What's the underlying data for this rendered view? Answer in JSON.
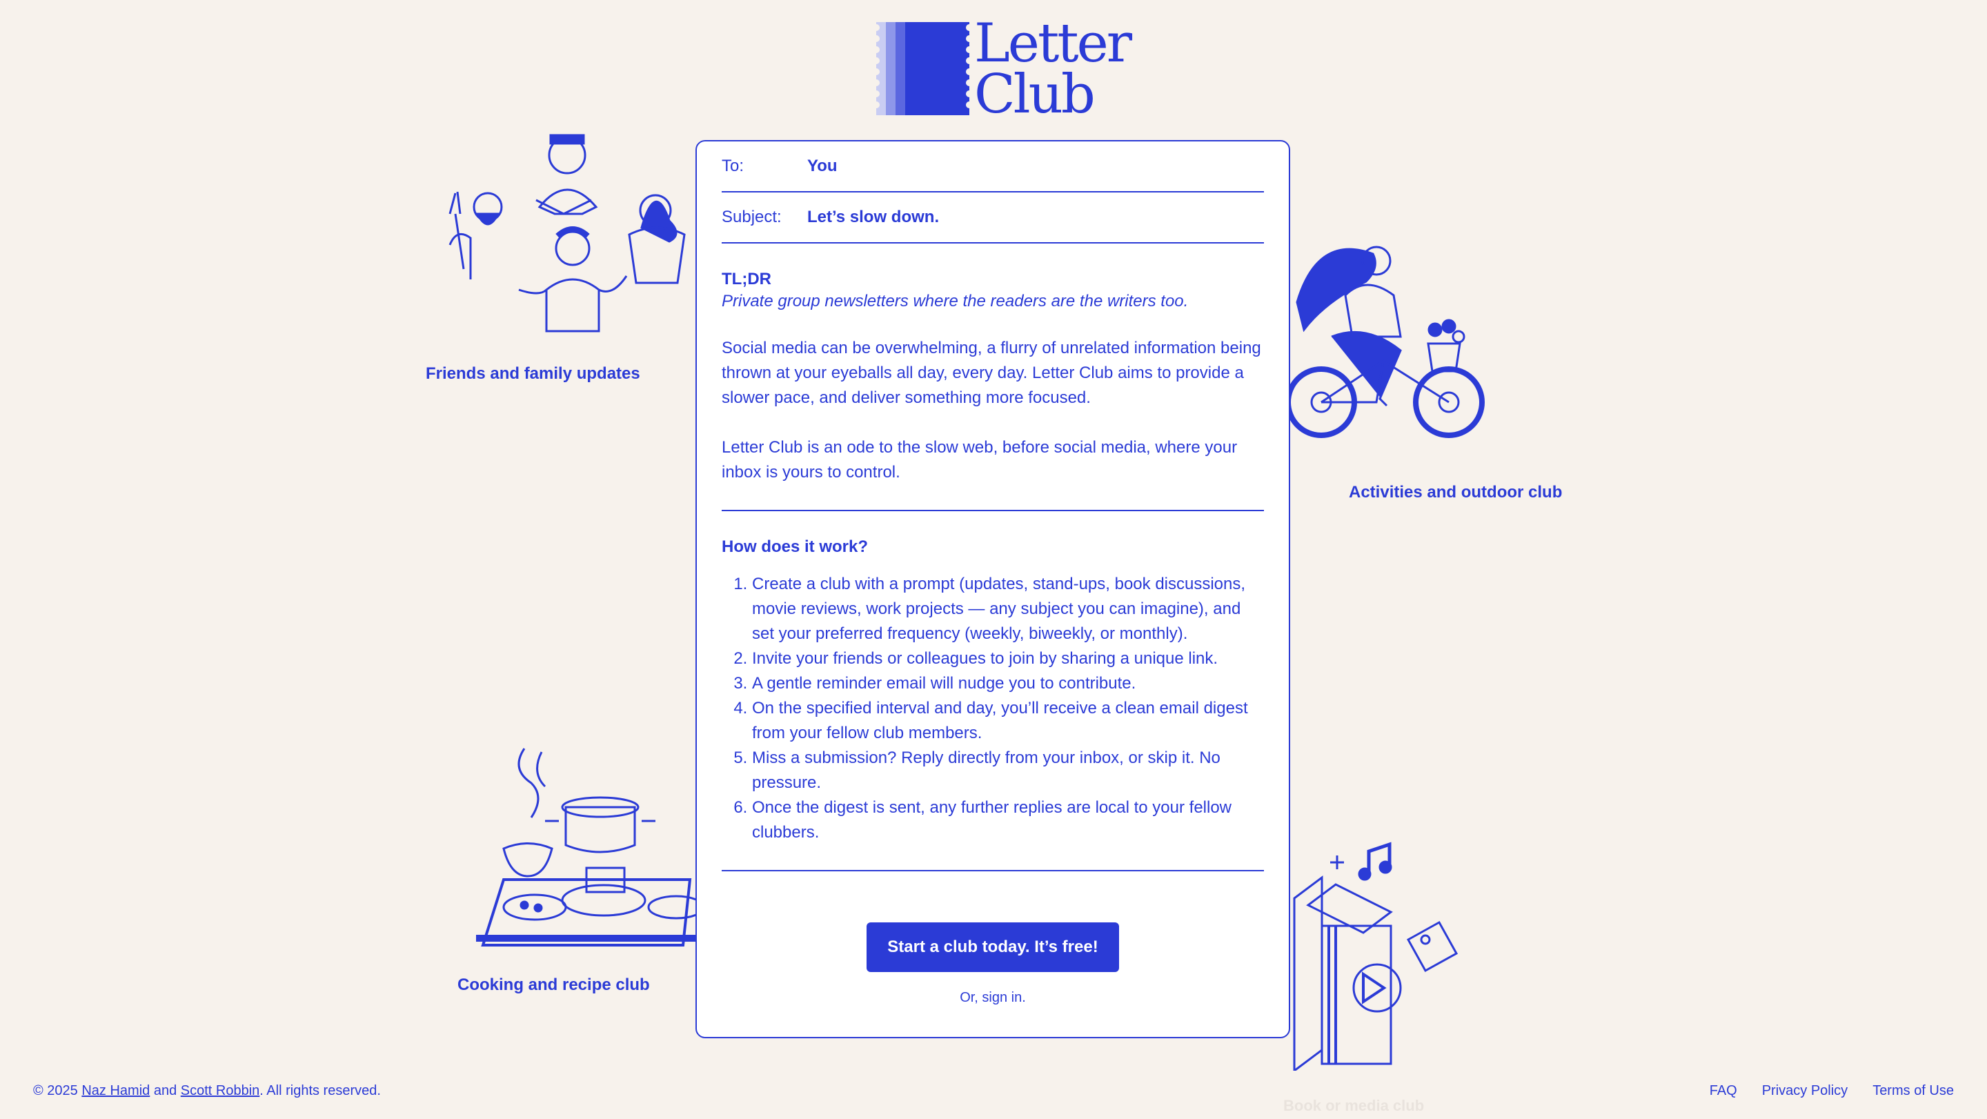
{
  "logo": {
    "line1": "Letter",
    "line2": "Club"
  },
  "letter": {
    "to_label": "To:",
    "to_value": "You",
    "subject_label": "Subject:",
    "subject_value": "Let’s slow down.",
    "tldr_title": "TL;DR",
    "tldr_sub": "Private group newsletters where the readers are the writers too.",
    "para1": "Social media can be overwhelming, a flurry of unrelated information being thrown at your eyeballs all day, every day. Letter Club aims to provide a slower pace, and deliver something more focused.",
    "para2": "Letter Club is an ode to the slow web, before social media, where your inbox is yours to control.",
    "how_title": "How does it work?",
    "steps": [
      "Create a club with a prompt (updates, stand-ups, book discussions, movie reviews, work projects — any subject you can imagine), and set your preferred frequency (weekly, biweekly, or monthly).",
      "Invite your friends or colleagues to join by sharing a unique link.",
      "A gentle reminder email will nudge you to contribute.",
      "On the specified interval and day, you’ll receive a clean email digest from your fellow club members.",
      "Miss a submission? Reply directly from your inbox, or skip it. No pressure.",
      "Once the digest is sent, any further replies are local to your fellow clubbers."
    ],
    "cta": "Start a club today. It’s free!",
    "signin": "Or, sign in."
  },
  "labels": {
    "friends": "Friends and family updates",
    "activities": "Activities and outdoor club",
    "cooking": "Cooking and recipe club",
    "faded": "Book or media club"
  },
  "footer": {
    "copyright_prefix": "© 2025",
    "author1": "Naz Hamid",
    "and": "and",
    "author2": "Scott Robbin",
    "rights": ". All rights reserved.",
    "links": [
      "FAQ",
      "Privacy Policy",
      "Terms of Use"
    ]
  },
  "colors": {
    "accent": "#2b3bd6",
    "background": "#f7f2ec",
    "card": "#ffffff"
  }
}
